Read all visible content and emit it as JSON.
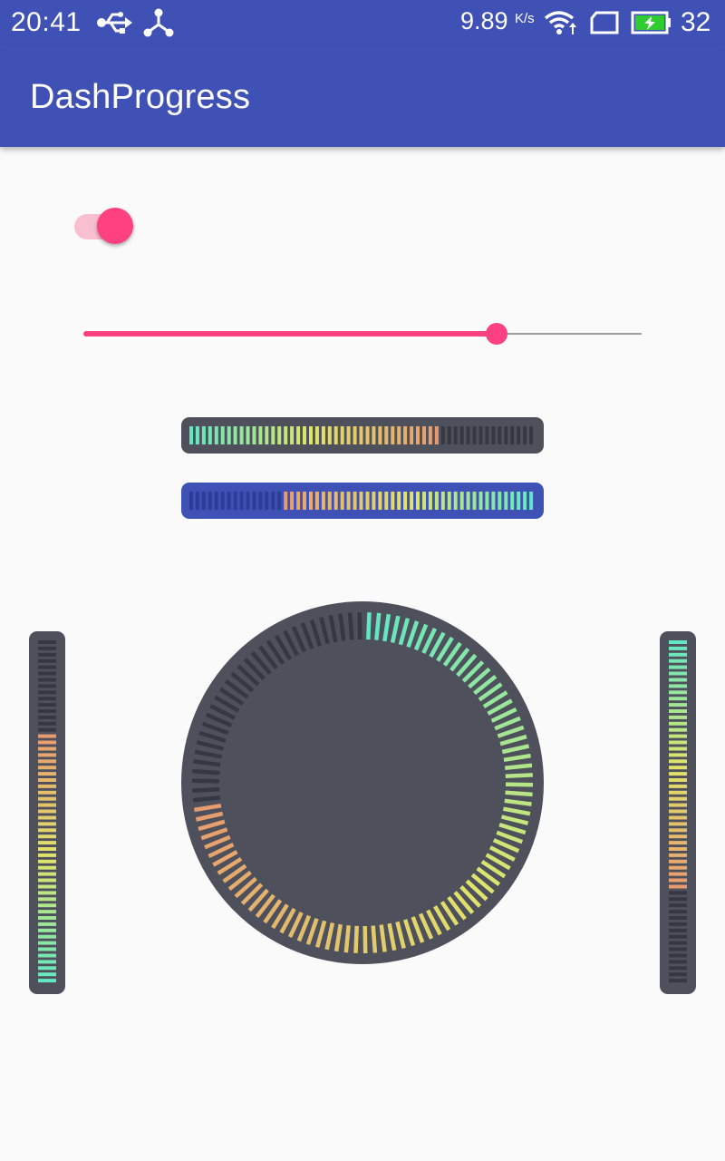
{
  "status_bar": {
    "time": "20:41",
    "network_speed": "9.89",
    "network_speed_unit": "K/s",
    "battery_level": "32",
    "icons": [
      "usb-icon",
      "share-icon",
      "wifi-icon",
      "sim-card-icon",
      "battery-charging-icon"
    ]
  },
  "app_bar": {
    "title": "DashProgress"
  },
  "toggle_switch": {
    "checked": true
  },
  "seek_bar": {
    "progress": 0.74
  },
  "dash_bars": {
    "horizontal_dark": {
      "progress": 0.72,
      "direction": "left-to-right",
      "background": "#4E515B"
    },
    "horizontal_blue": {
      "progress": 0.73,
      "direction": "right-to-left",
      "background": "#3F51B5"
    },
    "vertical_left": {
      "progress": 0.73,
      "direction": "bottom-to-top",
      "background": "#4E515B"
    },
    "vertical_right": {
      "progress": 0.73,
      "direction": "top-to-bottom",
      "background": "#4E515B"
    },
    "circular": {
      "progress": 0.73,
      "direction": "clockwise-from-top",
      "background": "#4E515B"
    }
  },
  "colors": {
    "primary": "#3F51B5",
    "accent": "#FF4081",
    "switch_track": "#F9BFD0",
    "seek_rail": "#9E9E9E",
    "dash_inactive_dark": "#353843",
    "dash_inactive_blue": "#2C3D98",
    "gradient": [
      "#5FE7C4",
      "#E0E46A",
      "#E89A6E"
    ]
  }
}
